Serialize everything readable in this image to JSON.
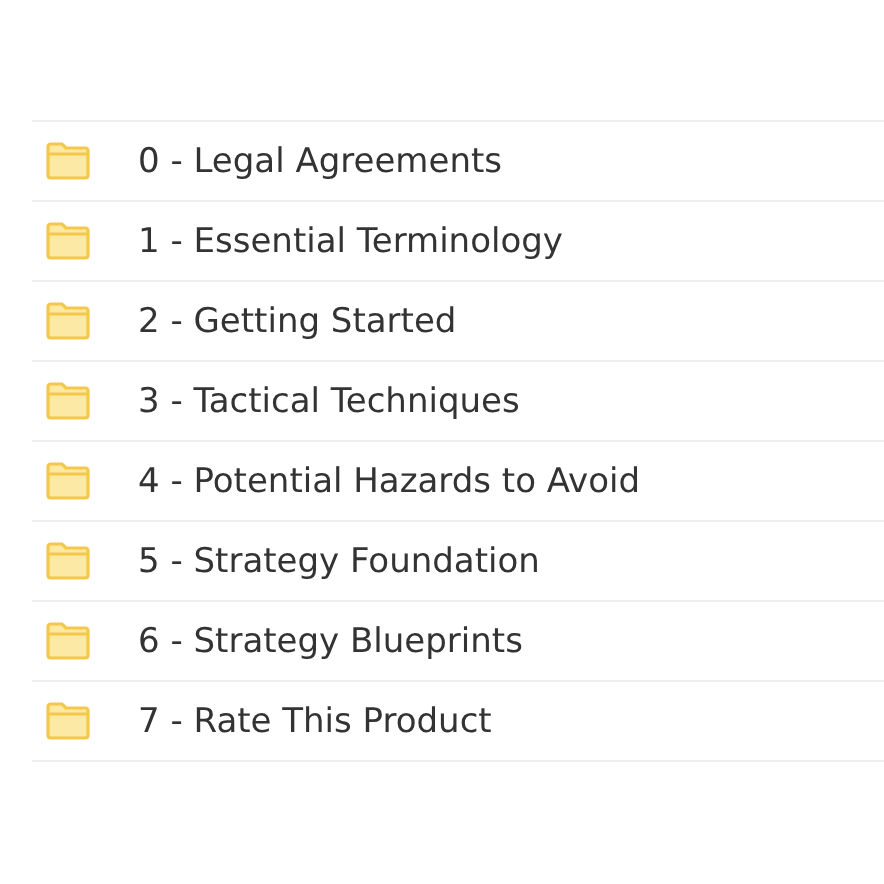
{
  "folders": [
    {
      "name": "0 - Legal Agreements"
    },
    {
      "name": "1 - Essential Terminology"
    },
    {
      "name": "2 - Getting Started"
    },
    {
      "name": "3 - Tactical Techniques"
    },
    {
      "name": "4 - Potential Hazards to Avoid"
    },
    {
      "name": "5 - Strategy Foundation"
    },
    {
      "name": "6 - Strategy Blueprints"
    },
    {
      "name": "7 - Rate This Product"
    }
  ]
}
